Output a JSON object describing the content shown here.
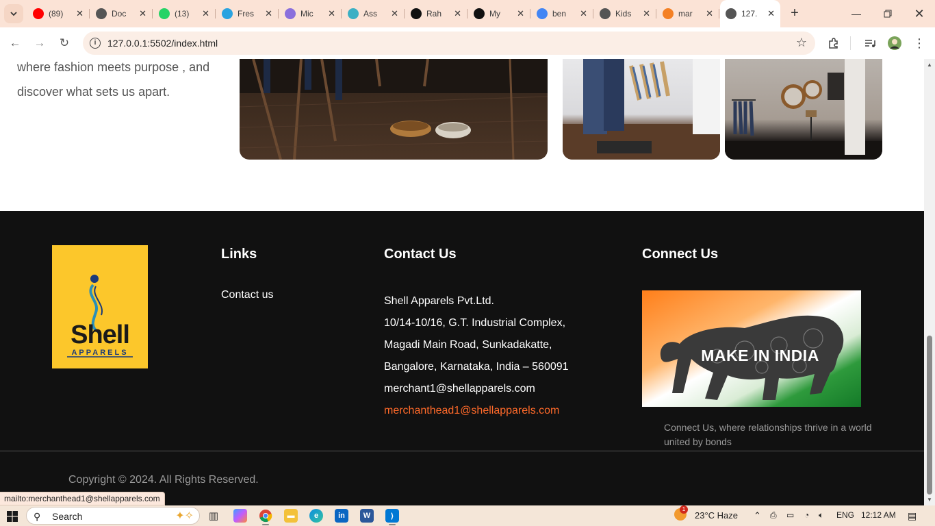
{
  "browser": {
    "tabs": [
      {
        "title": "(89)",
        "icon": "youtube-icon",
        "color": "#ff0000"
      },
      {
        "title": "Doc",
        "icon": "globe-icon",
        "color": "#555555"
      },
      {
        "title": "(13)",
        "icon": "whatsapp-icon",
        "color": "#25d366"
      },
      {
        "title": "Fres",
        "icon": "telegram-icon",
        "color": "#2aa3e0"
      },
      {
        "title": "Mic",
        "icon": "copilot-icon",
        "color": "#8a6fdc"
      },
      {
        "title": "Ass",
        "icon": "link-icon",
        "color": "#3bb0c4"
      },
      {
        "title": "Rah",
        "icon": "github-icon",
        "color": "#111111"
      },
      {
        "title": "My",
        "icon": "github-icon",
        "color": "#111111"
      },
      {
        "title": "ben",
        "icon": "google-icon",
        "color": "#4285f4"
      },
      {
        "title": "Kids",
        "icon": "globe-icon",
        "color": "#555555"
      },
      {
        "title": "mar",
        "icon": "stackoverflow-icon",
        "color": "#f48024"
      },
      {
        "title": "127.",
        "icon": "globe-icon",
        "color": "#555555",
        "active": true
      }
    ],
    "url": "127.0.0.1:5502/index.html"
  },
  "page": {
    "intro_text": "where fashion meets purpose , and discover what sets us apart.",
    "footer": {
      "logo_name": "Shell",
      "logo_sub": "APPARELS",
      "links_heading": "Links",
      "links": [
        "Contact us"
      ],
      "contact_heading": "Contact Us",
      "contact_lines": [
        "Shell Apparels Pvt.Ltd.",
        "10/14-10/16, G.T. Industrial Complex,",
        "Magadi Main Road, Sunkadakatte,",
        "Bangalore, Karnataka, India – 560091",
        "merchant1@shellapparels.com",
        "merchanthead1@shellapparels.com"
      ],
      "connect_heading": "Connect Us",
      "make_in_india": "MAKE IN INDIA",
      "connect_description": "Connect Us, where relationships thrive in a world united by bonds",
      "copyright": "Copyright © 2024. All Rights Reserved."
    },
    "status_url": "mailto:merchanthead1@shellapparels.com"
  },
  "taskbar": {
    "search_label": "Search",
    "weather": "23°C  Haze",
    "weather_badge": "1",
    "language": "ENG",
    "time": "12:12 AM"
  },
  "colors": {
    "footer_bg": "#111111",
    "logo_bg": "#fcc72b",
    "email_accent": "#ff6a2a",
    "tabstrip_bg": "#fbe3d6"
  }
}
